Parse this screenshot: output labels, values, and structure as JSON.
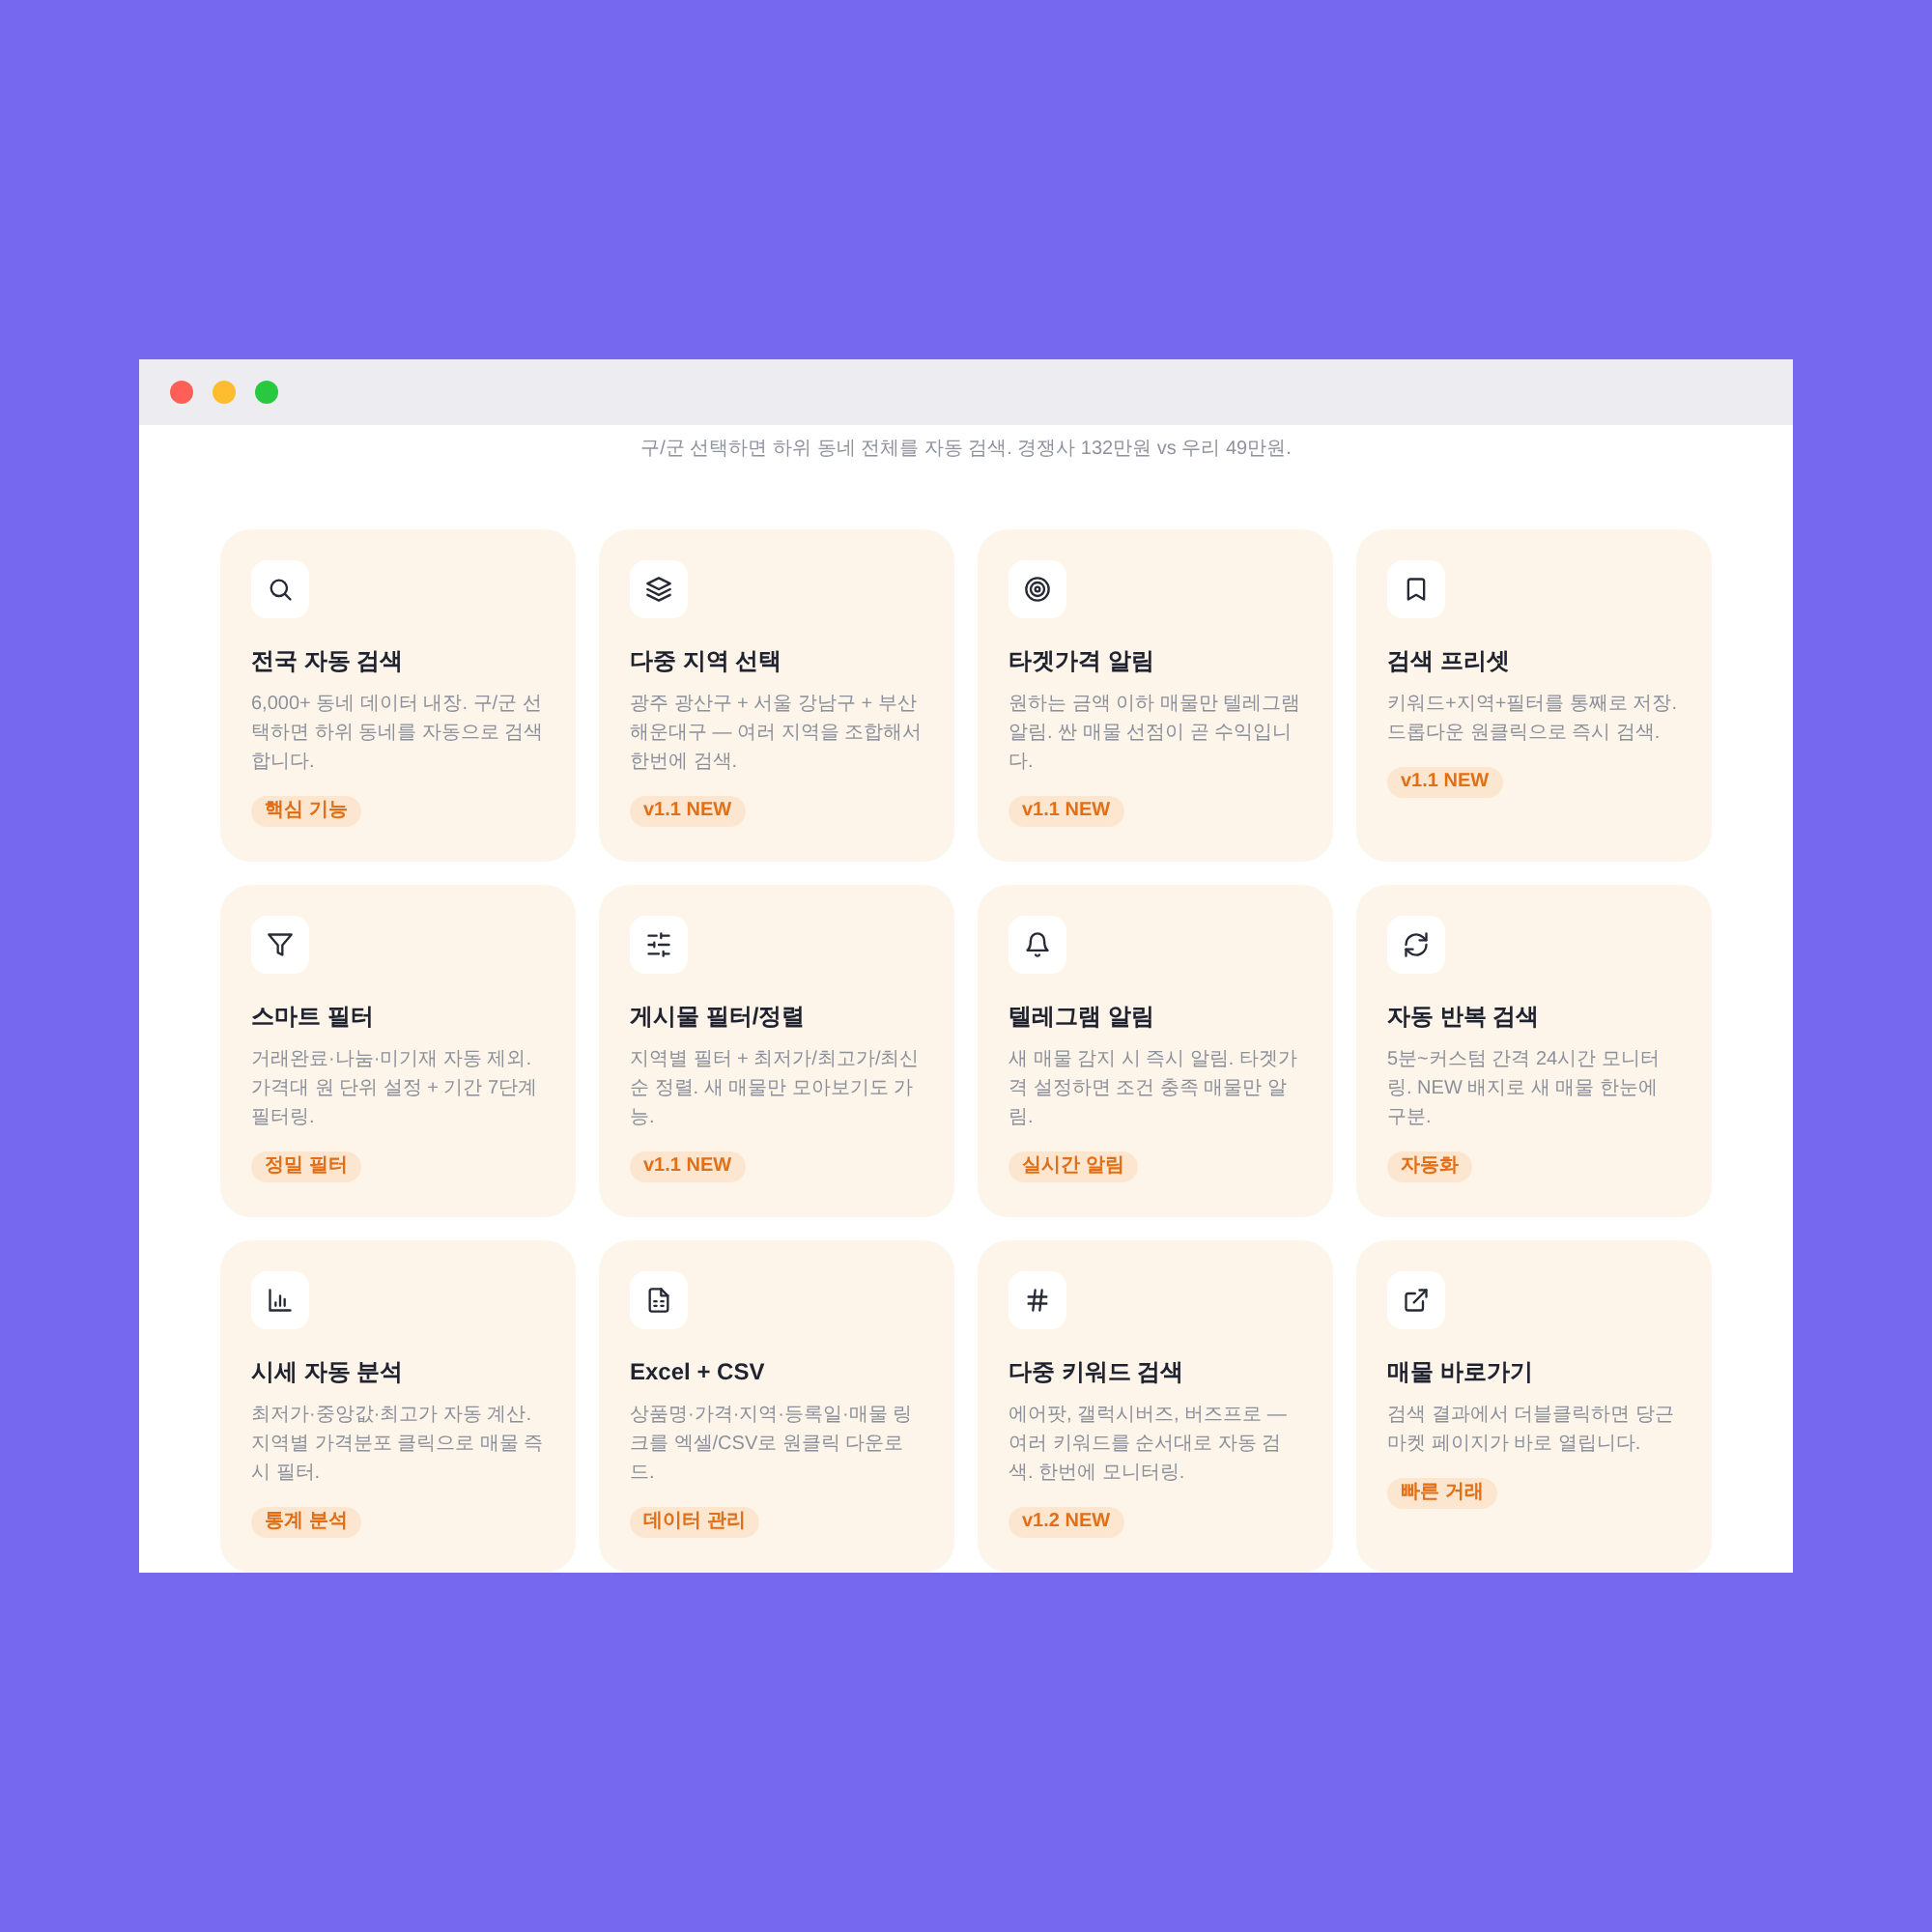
{
  "window": {
    "controls": [
      {
        "color": "#ff5f57"
      },
      {
        "color": "#febc2e"
      },
      {
        "color": "#28c840"
      }
    ]
  },
  "subtitle": "구/군 선택하면 하위 동네 전체를 자동 검색. 경쟁사 132만원 vs 우리 49만원.",
  "features": [
    {
      "kind": "search",
      "title": "전국 자동 검색",
      "description": "6,000+ 동네 데이터 내장. 구/군 선택하면 하위 동네를 자동으로 검색합니다.",
      "tag": "핵심 기능"
    },
    {
      "kind": "region",
      "title": "다중 지역 선택",
      "description": "광주 광산구 + 서울 강남구 + 부산 해운대구 — 여러 지역을 조합해서 한번에 검색.",
      "tag": "v1.1 NEW"
    },
    {
      "kind": "target",
      "title": "타겟가격 알림",
      "description": "원하는 금액 이하 매물만 텔레그램 알림. 싼 매물 선점이 곧 수익입니다.",
      "tag": "v1.1 NEW"
    },
    {
      "kind": "preset",
      "title": "검색 프리셋",
      "description": "키워드+지역+필터를 통째로 저장. 드롭다운 원클릭으로 즉시 검색.",
      "tag": "v1.1 NEW"
    },
    {
      "kind": "filter",
      "title": "스마트 필터",
      "description": "거래완료·나눔·미기재 자동 제외. 가격대 원 단위 설정 + 기간 7단계 필터링.",
      "tag": "정밀 필터"
    },
    {
      "kind": "sort",
      "title": "게시물 필터/정렬",
      "description": "지역별 필터 + 최저가/최고가/최신순 정렬. 새 매물만 모아보기도 가능.",
      "tag": "v1.1 NEW"
    },
    {
      "kind": "alert",
      "title": "텔레그램 알림",
      "description": "새 매물 감지 시 즉시 알림. 타겟가격 설정하면 조건 충족 매물만 알림.",
      "tag": "실시간 알림"
    },
    {
      "kind": "repeat",
      "title": "자동 반복 검색",
      "description": "5분~커스텀 간격 24시간 모니터링. NEW 배지로 새 매물 한눈에 구분.",
      "tag": "자동화"
    },
    {
      "kind": "stats",
      "title": "시세 자동 분석",
      "description": "최저가·중앙값·최고가 자동 계산. 지역별 가격분포 클릭으로 매물 즉시 필터.",
      "tag": "통계 분석"
    },
    {
      "kind": "export",
      "title": "Excel + CSV",
      "description": "상품명·가격·지역·등록일·매물 링크를 엑셀/CSV로 원클릭 다운로드.",
      "tag": "데이터 관리"
    },
    {
      "kind": "keywords",
      "title": "다중 키워드 검색",
      "description": "에어팟, 갤럭시버즈, 버즈프로 — 여러 키워드를 순서대로 자동 검색. 한번에 모니터링.",
      "tag": "v1.2 NEW"
    },
    {
      "kind": "shortcut",
      "title": "매물 바로가기",
      "description": "검색 결과에서 더블클릭하면 당근마켓 페이지가 바로 열립니다.",
      "tag": "빠른 거래"
    }
  ]
}
